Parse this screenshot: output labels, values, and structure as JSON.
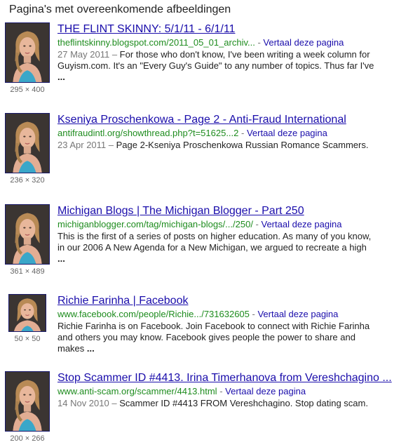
{
  "heading": "Pagina's met overeenkomende afbeeldingen",
  "results": [
    {
      "title": "THE FLINT SKINNY: 5/1/11 - 6/1/11",
      "url": "theflintskinny.blogspot.com/2011_05_01_archiv...",
      "separator": " - ",
      "translate": "Vertaal deze pagina",
      "date": "27 May 2011",
      "date_sep": " – ",
      "snippet": "For those who don't know, I've been writing a week column for Guyism.com. It's an \"Every Guy's Guide\" to any number of topics. Thus far I've",
      "ellipsis": " ...",
      "image_size": "295 × 400"
    },
    {
      "title": "Kseniya Proschenkowa - Page 2 - Anti-Fraud International",
      "url": "antifraudintl.org/showthread.php?t=51625...2",
      "separator": " - ",
      "translate": "Vertaal deze pagina",
      "date": "23 Apr 2011",
      "date_sep": " – ",
      "snippet": "Page 2-Kseniya Proschenkowa Russian Romance Scammers.",
      "ellipsis": "",
      "image_size": "236 × 320"
    },
    {
      "title": "Michigan Blogs | The Michigan Blogger - Part 250",
      "url": "michiganblogger.com/tag/michigan-blogs/.../250/",
      "separator": " - ",
      "translate": "Vertaal deze pagina",
      "date": "",
      "date_sep": "",
      "snippet": "This is the first of a series of posts on higher education. As many of you know, in our 2006 A New Agenda for a New Michigan, we argued to recreate a high",
      "ellipsis": " ...",
      "image_size": "361 × 489"
    },
    {
      "title": "Richie Farinha | Facebook",
      "url": "www.facebook.com/people/Richie.../731632605",
      "separator": " - ",
      "translate": "Vertaal deze pagina",
      "date": "",
      "date_sep": "",
      "snippet": "Richie Farinha is on Facebook. Join Facebook to connect with Richie Farinha and others you may know. Facebook gives people the power to share and makes",
      "ellipsis": " ...",
      "image_size": "50 × 50"
    },
    {
      "title": "Stop Scammer ID #4413. Irina Timerhanova from Vereshchagino ...",
      "url": "www.anti-scam.org/scammer/4413.html",
      "separator": " - ",
      "translate": "Vertaal deze pagina",
      "date": "14 Nov 2010",
      "date_sep": " – ",
      "snippet": "Scammer ID #4413 FROM Vereshchagino. Stop dating scam.",
      "ellipsis": "",
      "image_size": "200 × 266"
    }
  ]
}
